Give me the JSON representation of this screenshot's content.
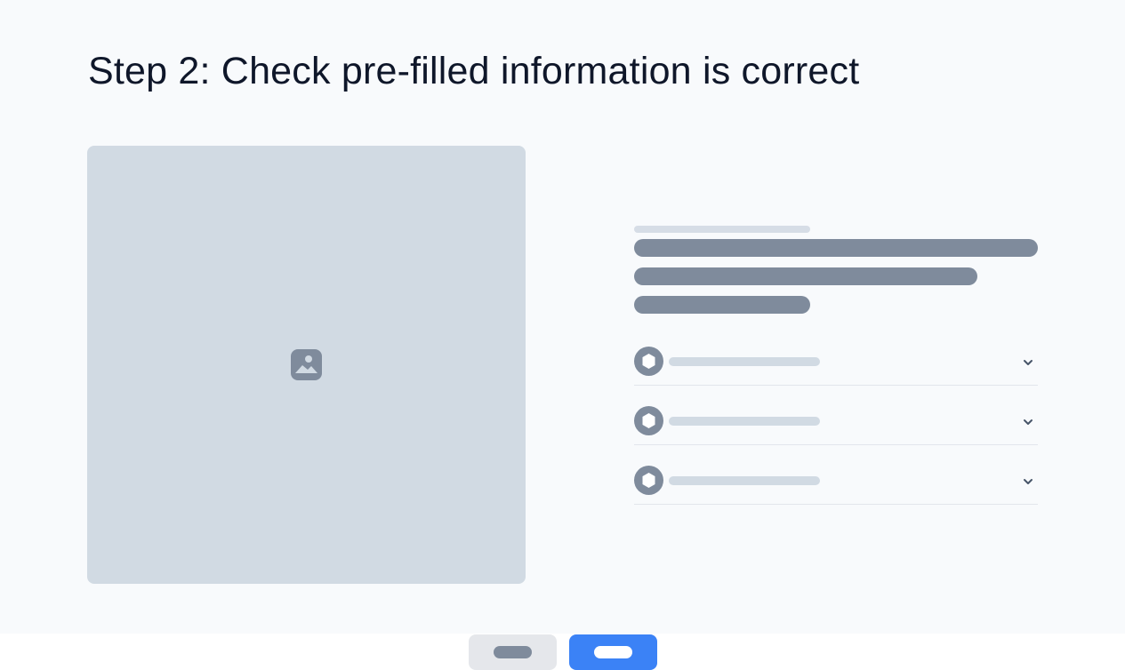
{
  "page": {
    "title": "Step 2: Check pre-filled information is correct"
  },
  "preview": {
    "icon": "image-icon"
  },
  "details": {
    "accordion_items": [
      {
        "icon": "badge-icon",
        "chevron": "chevron-down-icon"
      },
      {
        "icon": "badge-icon",
        "chevron": "chevron-down-icon"
      },
      {
        "icon": "badge-icon",
        "chevron": "chevron-down-icon"
      }
    ]
  },
  "footer": {
    "back_button": {
      "color": "#e5e7eb"
    },
    "next_button": {
      "color": "#3b82f6"
    }
  },
  "colors": {
    "accent": "#3b82f6",
    "skeleton_dark": "#7f8b9c",
    "skeleton_light": "#d1dae3",
    "background": "#f8fafc"
  }
}
